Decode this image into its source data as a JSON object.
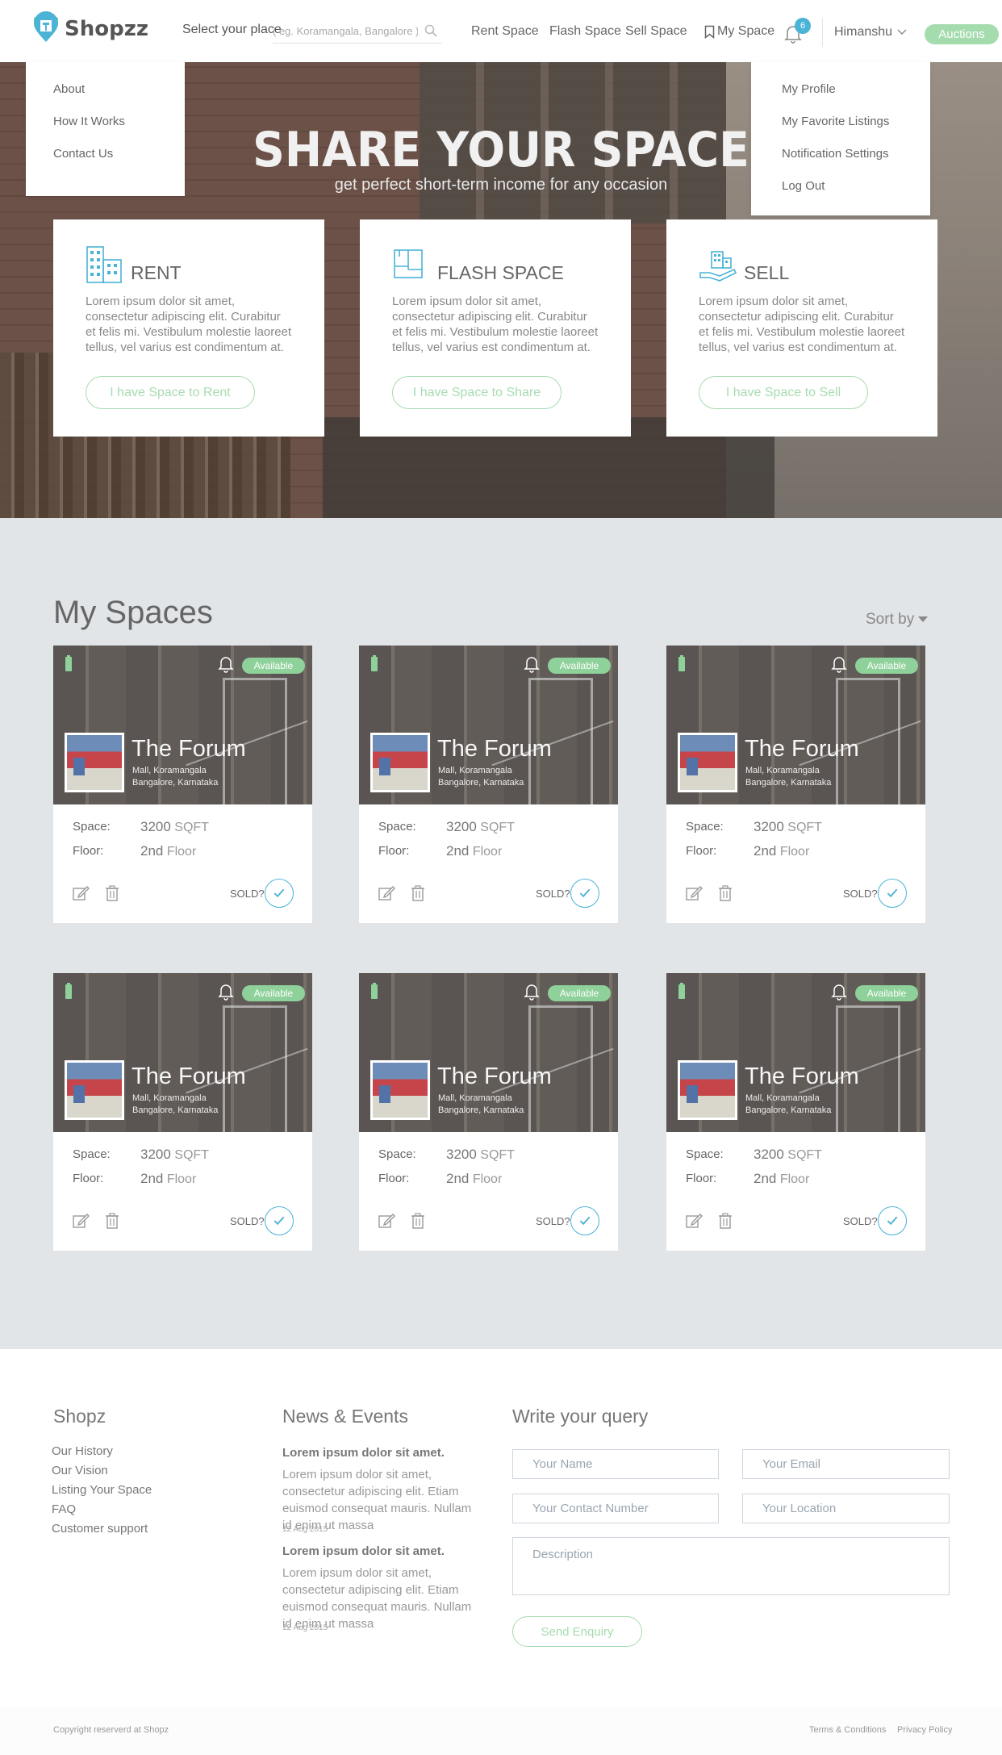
{
  "header": {
    "logo": "Shopzz",
    "place_label": "Select your place",
    "search_placeholder": "( eg. Koramangala, Bangalore )",
    "nav": [
      "Rent  Space",
      "Flash Space",
      "Sell Space"
    ],
    "my_space": "My Space",
    "notif_count": "6",
    "user": "Himanshu",
    "auctions": "Auctions"
  },
  "left_menu": [
    "About",
    "How It Works",
    "Contact Us"
  ],
  "user_menu": [
    "My Profile",
    "My Favorite Listings",
    "Notification Settings",
    "Log Out"
  ],
  "hero": {
    "title": "SHARE YOUR SPACE",
    "subtitle": "get perfect short-term income for any occasion"
  },
  "cards": [
    {
      "title": "RENT",
      "text": "Lorem ipsum dolor sit amet, consectetur adipiscing elit. Curabitur et felis mi. Vestibulum molestie laoreet tellus, vel varius est condimentum at.",
      "button": "I have Space to Rent",
      "icon": "building-icon"
    },
    {
      "title": "FLASH SPACE",
      "text": "Lorem ipsum dolor sit amet, consectetur adipiscing elit. Curabitur et felis mi. Vestibulum molestie laoreet tellus, vel varius est condimentum at.",
      "button": "I have Space to Share",
      "icon": "floorplan-icon"
    },
    {
      "title": "SELL",
      "text": "Lorem ipsum dolor sit amet, consectetur adipiscing elit. Curabitur et felis mi. Vestibulum molestie laoreet tellus, vel varius est condimentum at.",
      "button": "I have Space to Sell",
      "icon": "hand-building-icon"
    }
  ],
  "spaces": {
    "title": "My Spaces",
    "sort_by": "Sort by",
    "items": [
      {
        "status": "Available",
        "name": "The Forum",
        "loc1": "Mall, Koramangala",
        "loc2": "Bangalore, Karnataka",
        "space_label": "Space:",
        "space_num": "3200",
        "space_unit": "SQFT",
        "floor_label": "Floor:",
        "floor_num": "2nd",
        "floor_unit": "Floor",
        "sold": "SOLD?"
      },
      {
        "status": "Available",
        "name": "The Forum",
        "loc1": "Mall, Koramangala",
        "loc2": "Bangalore, Karnataka",
        "space_label": "Space:",
        "space_num": "3200",
        "space_unit": "SQFT",
        "floor_label": "Floor:",
        "floor_num": "2nd",
        "floor_unit": "Floor",
        "sold": "SOLD?"
      },
      {
        "status": "Available",
        "name": "The Forum",
        "loc1": "Mall, Koramangala",
        "loc2": "Bangalore, Karnataka",
        "space_label": "Space:",
        "space_num": "3200",
        "space_unit": "SQFT",
        "floor_label": "Floor:",
        "floor_num": "2nd",
        "floor_unit": "Floor",
        "sold": "SOLD?"
      },
      {
        "status": "Available",
        "name": "The Forum",
        "loc1": "Mall, Koramangala",
        "loc2": "Bangalore, Karnataka",
        "space_label": "Space:",
        "space_num": "3200",
        "space_unit": "SQFT",
        "floor_label": "Floor:",
        "floor_num": "2nd",
        "floor_unit": "Floor",
        "sold": "SOLD?"
      },
      {
        "status": "Available",
        "name": "The Forum",
        "loc1": "Mall, Koramangala",
        "loc2": "Bangalore, Karnataka",
        "space_label": "Space:",
        "space_num": "3200",
        "space_unit": "SQFT",
        "floor_label": "Floor:",
        "floor_num": "2nd",
        "floor_unit": "Floor",
        "sold": "SOLD?"
      },
      {
        "status": "Available",
        "name": "The Forum",
        "loc1": "Mall, Koramangala",
        "loc2": "Bangalore, Karnataka",
        "space_label": "Space:",
        "space_num": "3200",
        "space_unit": "SQFT",
        "floor_label": "Floor:",
        "floor_num": "2nd",
        "floor_unit": "Floor",
        "sold": "SOLD?"
      }
    ]
  },
  "footer": {
    "shopz_title": "Shopz",
    "links": [
      "Our History",
      "Our Vision",
      "Listing Your Space",
      "FAQ",
      "Customer support"
    ],
    "news_title": "News & Events",
    "news": [
      {
        "title": "Lorem ipsum dolor sit amet.",
        "text": "Lorem ipsum dolor sit amet, consectetur adipiscing elit. Etiam euismod consequat mauris. Nullam id enim ut massa",
        "date": "12 Aug 2015"
      },
      {
        "title": "Lorem ipsum dolor sit amet.",
        "text": "Lorem ipsum dolor sit amet, consectetur adipiscing elit. Etiam euismod consequat mauris. Nullam id enim ut massa",
        "date": "12 Aug 2015"
      }
    ],
    "query_title": "Write your query",
    "ph_name": "Your Name",
    "ph_email": "Your Email",
    "ph_contact": "Your Contact Number",
    "ph_location": "Your Location",
    "ph_description": "Description",
    "send": "Send Enquiry",
    "copyright": "Copyright reserverd at Shopz",
    "terms": "Terms & Conditions",
    "privacy": "Privacy Policy"
  },
  "colors": {
    "accent_green": "#a5dcae",
    "accent_blue": "#4ab3d6",
    "section_bg": "#e1e5e8"
  }
}
